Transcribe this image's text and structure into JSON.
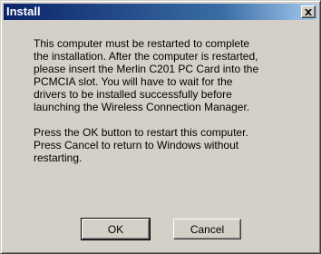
{
  "window": {
    "title": "Install",
    "close_icon": "close-icon"
  },
  "message": {
    "paragraph1": "This computer must be restarted to complete\nthe installation. After the computer is restarted,\nplease insert the Merlin C201 PC Card into the\nPCMCIA slot. You will have to wait for the\ndrivers to be installed successfully before\nlaunching the Wireless Connection Manager.",
    "paragraph2": "Press the OK button to restart this computer.\nPress Cancel to return to Windows without\nrestarting."
  },
  "buttons": {
    "ok_label": "OK",
    "cancel_label": "Cancel"
  },
  "colors": {
    "title_bar_start": "#0a246a",
    "title_bar_end": "#a6caf0",
    "dialog_face": "#d4d0c8"
  }
}
